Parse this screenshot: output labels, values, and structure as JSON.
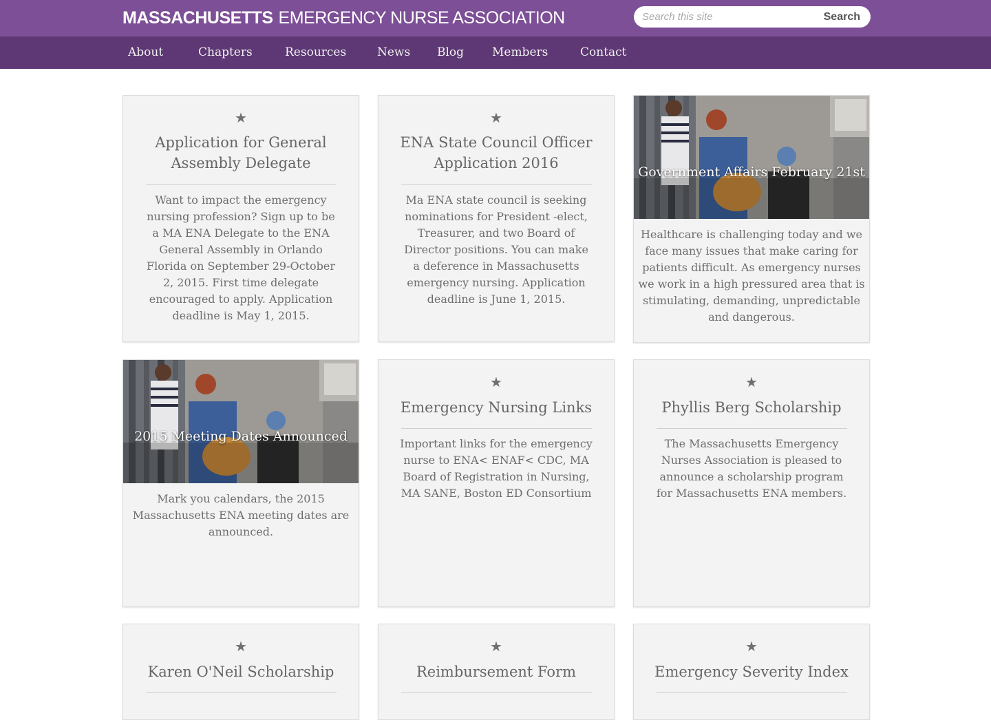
{
  "site": {
    "name_bold": "MASSACHUSETTS",
    "name_rest": "EMERGENCY NURSE ASSOCIATION"
  },
  "search": {
    "placeholder": "Search this site",
    "button_label": "Search"
  },
  "nav": [
    {
      "label": "About"
    },
    {
      "label": "Chapters"
    },
    {
      "label": "Resources"
    },
    {
      "label": "News"
    },
    {
      "label": "Blog"
    },
    {
      "label": "Members"
    },
    {
      "label": "Contact"
    }
  ],
  "cards": [
    {
      "title": "Application for General Assembly Delegate",
      "description": "Want to impact the emergency nursing profession? Sign up to be a MA ENA Delegate to the ENA General Assembly in Orlando Florida on September 29-October 2, 2015. First time delegate encouraged to apply. Application deadline is May 1, 2015.",
      "icon": "star-icon"
    },
    {
      "title": "ENA State Council Officer Application 2016",
      "description": "Ma ENA state council is seeking nominations for President -elect, Treasurer, and two Board of Director positions. You can make a deference in Massachusetts emergency nursing. Application deadline is June 1, 2015.",
      "icon": "star-icon"
    },
    {
      "title": "Government Affairs February 21st",
      "description": "Healthcare is challenging today and we face many issues that make caring for patients difficult. As emergency nurses we work in a high pressured area that is stimulating, demanding, unpredictable and dangerous.",
      "image": "street-photo"
    },
    {
      "title": "2015 Meeting Dates Announced",
      "description": "Mark you calendars, the 2015 Massachusetts ENA meeting dates are announced.",
      "image": "street-photo"
    },
    {
      "title": "Emergency Nursing Links",
      "description": "Important links for the emergency nurse to ENA< ENAF< CDC, MA Board of Registration in Nursing, MA SANE, Boston ED Consortium",
      "icon": "star-icon"
    },
    {
      "title": "Phyllis Berg Scholarship",
      "description": "The Massachusetts Emergency Nurses Association is pleased to announce a scholarship program for Massachusetts ENA members.",
      "icon": "star-icon"
    },
    {
      "title": "Karen O'Neil Scholarship",
      "description": "",
      "icon": "star-icon"
    },
    {
      "title": "Reimbursement Form",
      "description": "",
      "icon": "star-icon"
    },
    {
      "title": "Emergency Severity Index",
      "description": "",
      "icon": "star-icon"
    }
  ],
  "colors": {
    "header_purple": "#7d4f97",
    "nav_purple": "#5d3874",
    "card_bg": "#f3f3f3"
  }
}
